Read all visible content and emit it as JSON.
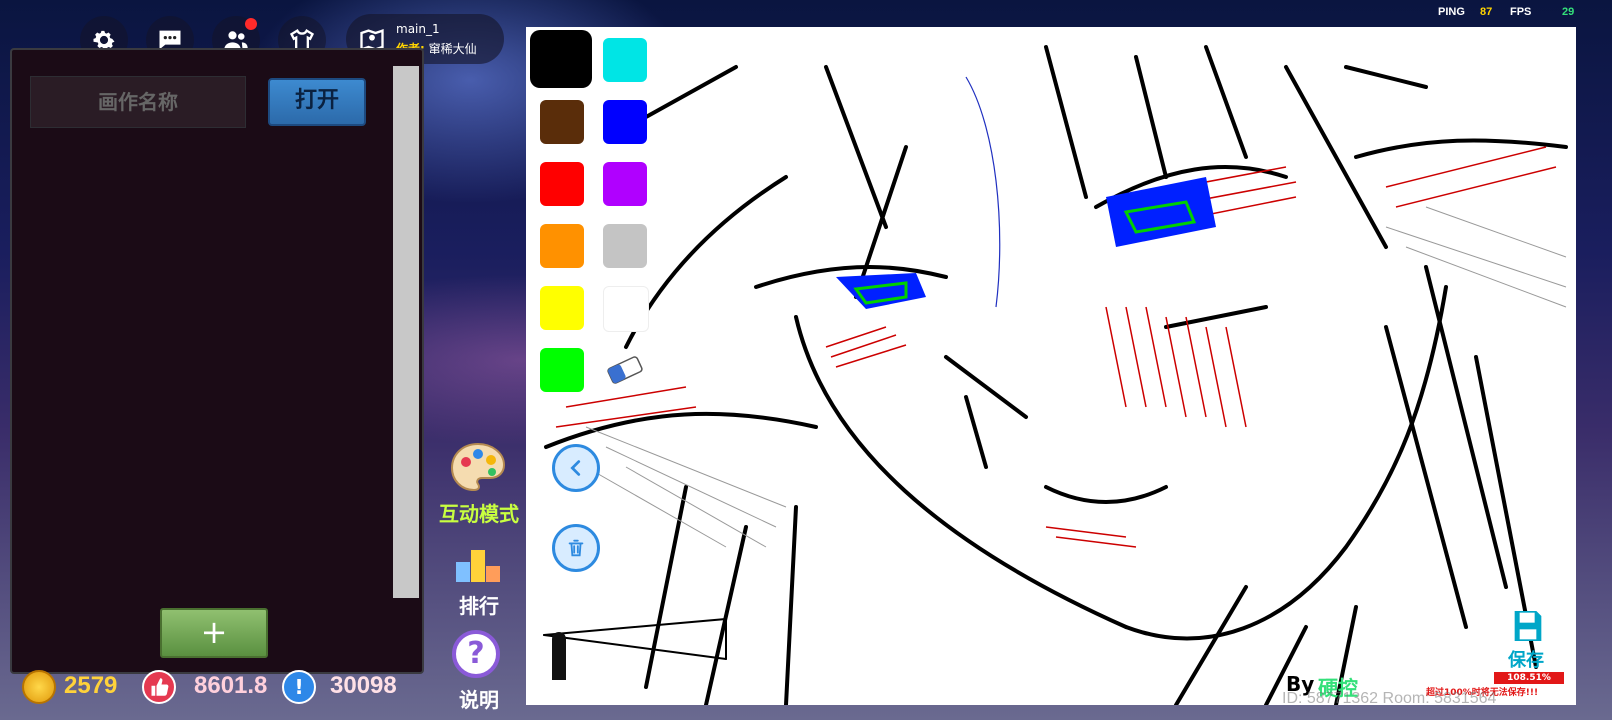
{
  "topbar": {
    "settings_icon": "gear-icon",
    "chat_icon": "chat-icon",
    "friends_icon": "friends-icon",
    "shirt_icon": "shirt-icon",
    "map_icon": "map-pin-icon",
    "map_name": "main_1",
    "author_label": "作者:",
    "author_name": "窜稀大仙",
    "ping_label": "PING",
    "ping_value": "87",
    "fps_label": "FPS",
    "fps_value": "29"
  },
  "panel": {
    "name_placeholder": "画作名称",
    "open_label": "打开",
    "add_label": "+"
  },
  "stats": {
    "coins": "2579",
    "likes": "8601.8",
    "points": "30098"
  },
  "side": {
    "interactive_label": "互动模式",
    "rank_label": "排行",
    "help_label": "说明",
    "help_symbol": "?"
  },
  "palette": {
    "colors": [
      "#000000",
      "#00e5e5",
      "#5a2d0a",
      "#0000ff",
      "#ff0000",
      "#b000ff",
      "#ff9100",
      "#c4c4c4",
      "#ffff00",
      "#ffffff",
      "#00ff00"
    ],
    "eraser_icon": "eraser-icon",
    "back_icon": "back-arrow-icon",
    "trash_icon": "trash-icon"
  },
  "canvas": {
    "signature_by": "By",
    "signature_name": "硬控",
    "save_label": "保存",
    "save_icon": "save-disk-icon",
    "percent": "108.51%",
    "warning": "超过100%时将无法保存!!!",
    "watermark": "ID: 58771362  Room: 5831564"
  },
  "colors": {
    "accent_blue": "#2d8ae0",
    "coin_gold": "#f5b70a",
    "like_red": "#e53950",
    "point_blue": "#2e88e8",
    "ping_value": "#ffd400",
    "fps_value": "#34e07a"
  }
}
